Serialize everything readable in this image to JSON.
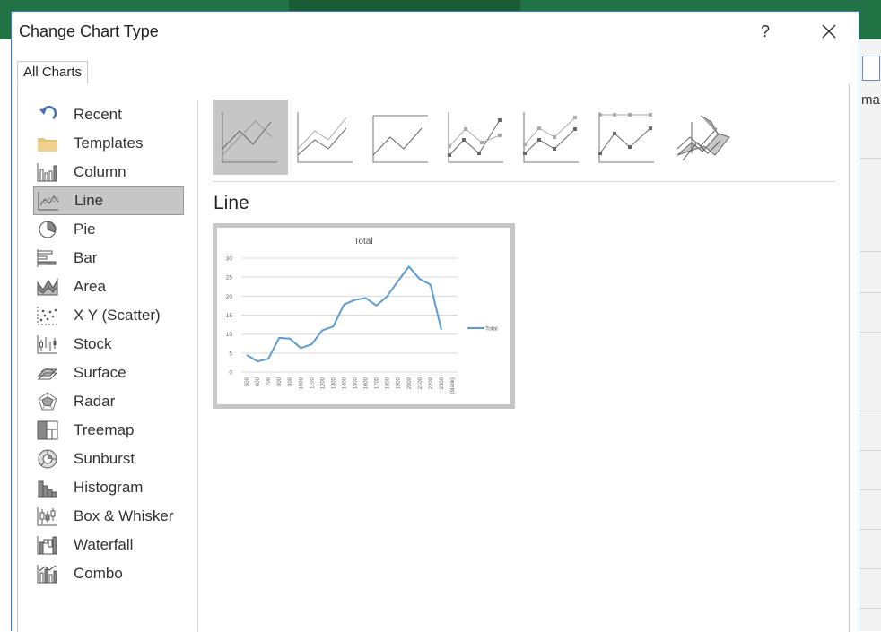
{
  "dialog": {
    "title": "Change Chart Type",
    "help_label": "?",
    "close_icon": "close-icon"
  },
  "tabs": [
    {
      "label": "All Charts",
      "active": true
    }
  ],
  "categories": [
    {
      "label": "Recent",
      "icon": "recent-icon"
    },
    {
      "label": "Templates",
      "icon": "folder-icon"
    },
    {
      "label": "Column",
      "icon": "column-chart-icon"
    },
    {
      "label": "Line",
      "icon": "line-chart-icon",
      "selected": true
    },
    {
      "label": "Pie",
      "icon": "pie-chart-icon"
    },
    {
      "label": "Bar",
      "icon": "bar-chart-icon"
    },
    {
      "label": "Area",
      "icon": "area-chart-icon"
    },
    {
      "label": "X Y (Scatter)",
      "icon": "scatter-chart-icon"
    },
    {
      "label": "Stock",
      "icon": "stock-chart-icon"
    },
    {
      "label": "Surface",
      "icon": "surface-chart-icon"
    },
    {
      "label": "Radar",
      "icon": "radar-chart-icon"
    },
    {
      "label": "Treemap",
      "icon": "treemap-chart-icon"
    },
    {
      "label": "Sunburst",
      "icon": "sunburst-chart-icon"
    },
    {
      "label": "Histogram",
      "icon": "histogram-chart-icon"
    },
    {
      "label": "Box & Whisker",
      "icon": "box-whisker-chart-icon"
    },
    {
      "label": "Waterfall",
      "icon": "waterfall-chart-icon"
    },
    {
      "label": "Combo",
      "icon": "combo-chart-icon"
    }
  ],
  "subtypes": [
    {
      "icon": "line-subtype-icon",
      "selected": true
    },
    {
      "icon": "stacked-line-subtype-icon"
    },
    {
      "icon": "100-stacked-line-subtype-icon"
    },
    {
      "icon": "line-with-markers-subtype-icon"
    },
    {
      "icon": "stacked-line-with-markers-subtype-icon"
    },
    {
      "icon": "100-stacked-line-with-markers-subtype-icon"
    },
    {
      "icon": "3d-line-subtype-icon"
    }
  ],
  "selected_subtype_name": "Line",
  "background": {
    "right_text": "ma"
  },
  "colors": {
    "line": "#5b9bd5",
    "selection": "#c6c6c6",
    "accent_border": "#2b7cd3",
    "excel_green": "#217346"
  },
  "chart_data": {
    "type": "line",
    "title": "Total",
    "categories": [
      "500",
      "600",
      "700",
      "800",
      "900",
      "1000",
      "1100",
      "1200",
      "1300",
      "1400",
      "1500",
      "1600",
      "1700",
      "1800",
      "1900",
      "2000",
      "2100",
      "2200",
      "2300",
      "(blank)"
    ],
    "series": [
      {
        "name": "Total",
        "values": [
          4.5,
          2.8,
          3.5,
          9,
          8.8,
          6.3,
          7.3,
          11,
          12,
          17.8,
          19,
          19.5,
          17.5,
          20,
          24,
          27.8,
          24.5,
          23,
          11.2
        ]
      }
    ],
    "yticks": [
      "0",
      "5",
      "10",
      "15",
      "20",
      "25",
      "30"
    ],
    "ylim": [
      0,
      30
    ],
    "grid": true,
    "legend": "right"
  }
}
